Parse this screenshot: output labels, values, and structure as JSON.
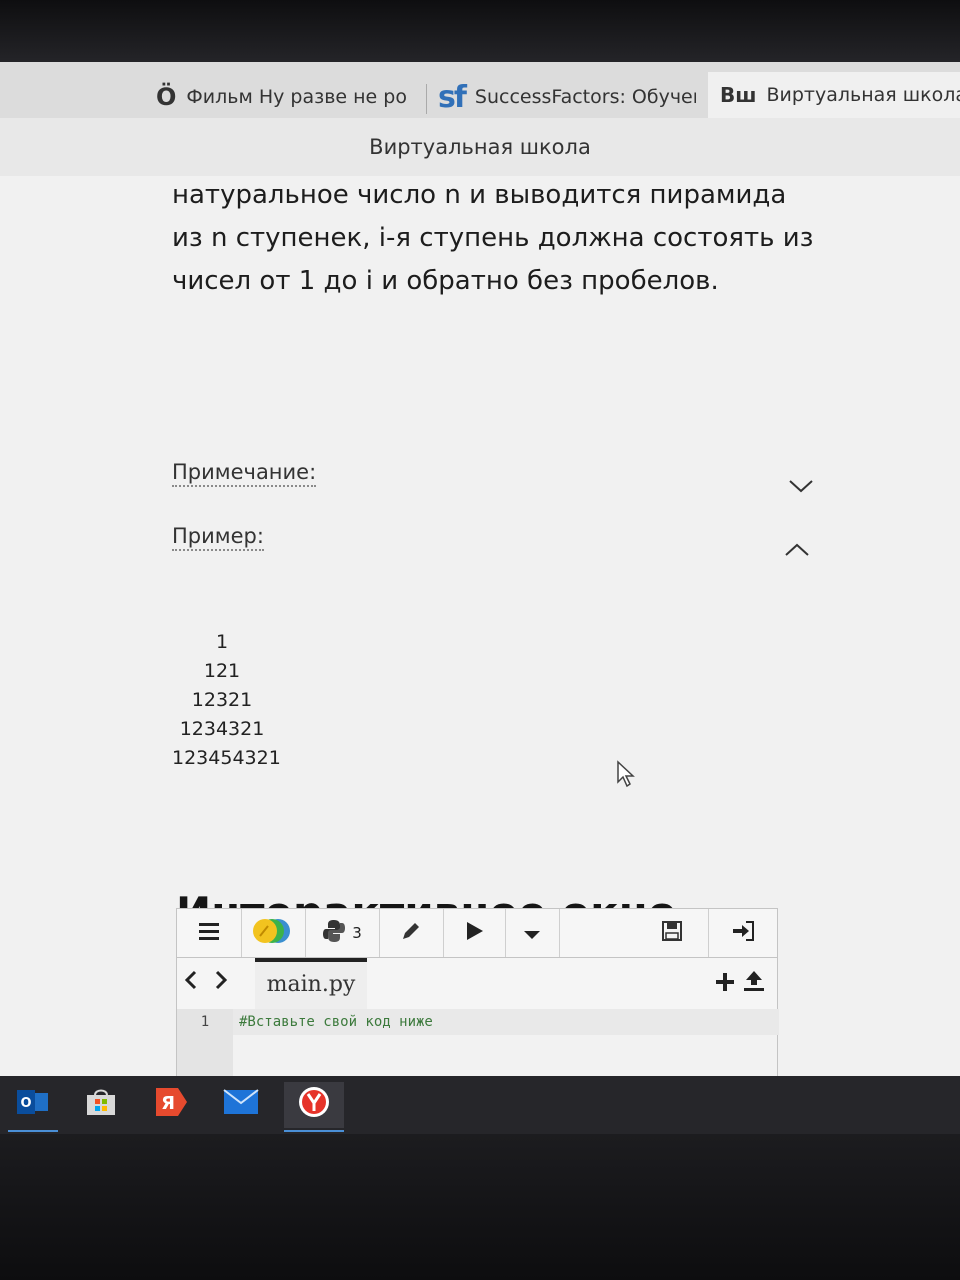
{
  "browser": {
    "tabs": [
      {
        "icon": "Ö",
        "title": "Фильм Ну разве не ро",
        "active": false
      },
      {
        "icon": "sf",
        "title": "SuccessFactors: Обучен",
        "active": false
      },
      {
        "icon": "Вш",
        "title": "Виртуальная школа",
        "active": true
      }
    ],
    "close_glyph": "×",
    "page_title": "Виртуальная школа"
  },
  "task": {
    "description": "натуральное число n и выводится пирамида из n ступенек, i-я ступень должна состоять из чисел от 1 до i и обратно без пробелов.",
    "note_label": "Примечание:",
    "example_label": "Пример:",
    "example_lines": [
      "1",
      "121",
      "12321",
      "1234321",
      "123454321"
    ]
  },
  "interactive": {
    "heading": "Интерактивное окно",
    "python_version": "3",
    "file_name": "main.py",
    "line_number": "1",
    "code": "#Вставьте свой код ниже"
  },
  "taskbar": {
    "apps": [
      "outlook-icon",
      "store-icon",
      "yandex-icon",
      "mail-icon",
      "yandex-browser-icon"
    ]
  },
  "colors": {
    "accent": "#4a8fd6",
    "comment": "#3c7a3c"
  }
}
